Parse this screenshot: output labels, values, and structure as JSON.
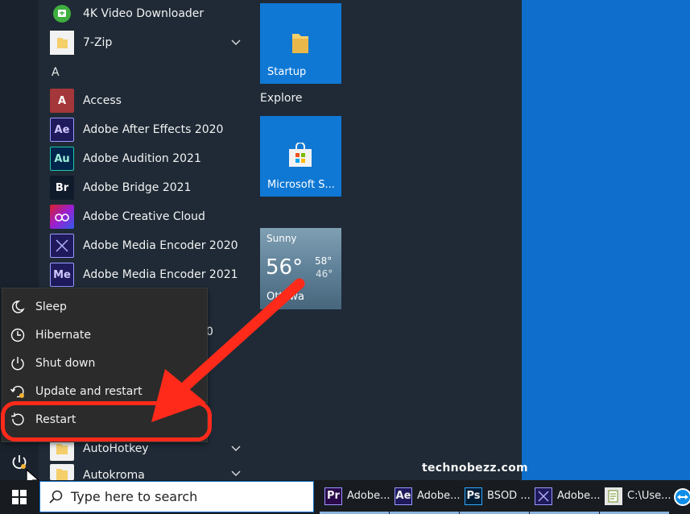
{
  "apps": {
    "letter_a": "A",
    "items": [
      {
        "label": "4K Video Downloader",
        "icon": "video-downloader-icon",
        "color": "#3fae3f"
      },
      {
        "label": "7-Zip",
        "icon": "folder-icon",
        "color": "#e8c36a"
      },
      {
        "label": "Access",
        "icon": "access-icon",
        "badge": "A",
        "color": "#a4373a"
      },
      {
        "label": "Adobe After Effects 2020",
        "icon": "after-effects-icon",
        "badge": "Ae",
        "color": "#1f1a5c"
      },
      {
        "label": "Adobe Audition 2021",
        "icon": "audition-icon",
        "badge": "Au",
        "color": "#00254d"
      },
      {
        "label": "Adobe Bridge 2021",
        "icon": "bridge-icon",
        "badge": "Br",
        "color": "#0f1b2a"
      },
      {
        "label": "Adobe Creative Cloud",
        "icon": "creative-cloud-icon",
        "color": "#da1f26"
      },
      {
        "label": "Adobe Media Encoder 2020",
        "icon": "media-encoder-icon",
        "color": "#1f1a5c"
      },
      {
        "label": "Adobe Media Encoder 2021",
        "icon": "media-encoder-icon",
        "badge": "Me",
        "color": "#1f1a5c"
      },
      {
        "label": "AutoHotkey",
        "icon": "folder-icon",
        "color": "#e8c36a"
      },
      {
        "label": "Autokroma",
        "icon": "folder-icon",
        "color": "#e8c36a"
      }
    ],
    "partial_text": "0"
  },
  "tiles": {
    "startup_label": "Startup",
    "explore_group": "Explore",
    "store_label": "Microsoft S...",
    "weather": {
      "condition": "Sunny",
      "temp": "56°",
      "high": "58°",
      "low": "46°",
      "city": "Ottawa"
    }
  },
  "power_menu": {
    "items": [
      {
        "label": "Sleep",
        "icon": "sleep-icon"
      },
      {
        "label": "Hibernate",
        "icon": "hibernate-icon"
      },
      {
        "label": "Shut down",
        "icon": "shut-down-icon"
      },
      {
        "label": "Update and restart",
        "icon": "update-restart-icon"
      },
      {
        "label": "Restart",
        "icon": "restart-icon"
      }
    ]
  },
  "annotation": {
    "ring_color": "#ff2a1a",
    "arrow_color": "#ff2a1a"
  },
  "taskbar": {
    "search_placeholder": "Type here to search",
    "apps": [
      {
        "label": "Adobe...",
        "badge": "Pr",
        "color": "#2a0a4a",
        "badge_color": "#9999ff"
      },
      {
        "label": "Adobe...",
        "badge": "Ae",
        "color": "#1f1a5c",
        "badge_color": "#9999ff"
      },
      {
        "label": "BSOD ...",
        "badge": "Ps",
        "color": "#001e36",
        "badge_color": "#31a8ff"
      },
      {
        "label": "Adobe...",
        "badge": "",
        "color": "#1f1a5c",
        "badge_color": "#9999ff"
      },
      {
        "label": "C:\\Use...",
        "badge": "",
        "color": "#6b8e23",
        "badge_color": "#ffffff"
      }
    ]
  },
  "watermark": "technobezz.com"
}
